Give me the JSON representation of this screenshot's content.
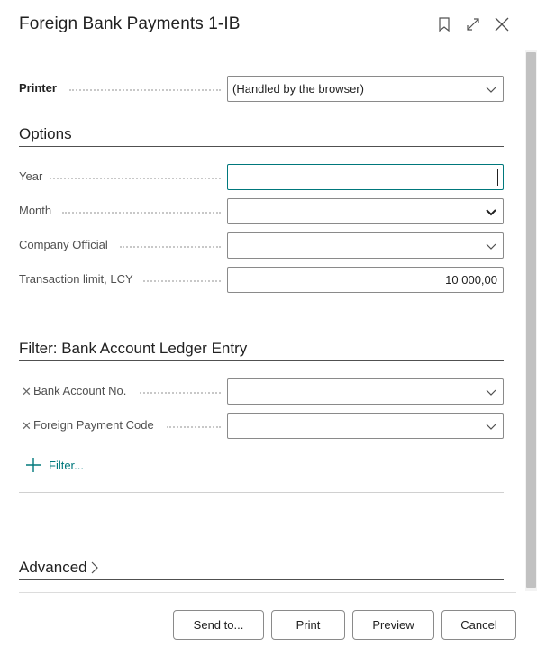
{
  "header": {
    "title": "Foreign Bank Payments 1-IB",
    "icons": [
      "bookmark-icon",
      "expand-icon",
      "close-icon"
    ]
  },
  "printer": {
    "label": "Printer",
    "value": "(Handled by the browser)"
  },
  "options": {
    "heading": "Options",
    "fields": [
      {
        "label": "Year",
        "value": ""
      },
      {
        "label": "Month",
        "value": ""
      },
      {
        "label": "Company Official",
        "value": ""
      },
      {
        "label": "Transaction limit, LCY",
        "value": "10 000,00"
      }
    ]
  },
  "filter": {
    "heading": "Filter: Bank Account Ledger Entry",
    "fields": [
      {
        "label": "Bank Account No.",
        "value": ""
      },
      {
        "label": "Foreign Payment Code",
        "value": ""
      }
    ],
    "add_filter_label": "Filter..."
  },
  "advanced": {
    "heading": "Advanced"
  },
  "footer": {
    "send_to_label": "Send to...",
    "print_label": "Print",
    "preview_label": "Preview",
    "cancel_label": "Cancel"
  },
  "colors": {
    "accent": "#00787c",
    "border": "#8a8a8a",
    "label": "#505050"
  }
}
